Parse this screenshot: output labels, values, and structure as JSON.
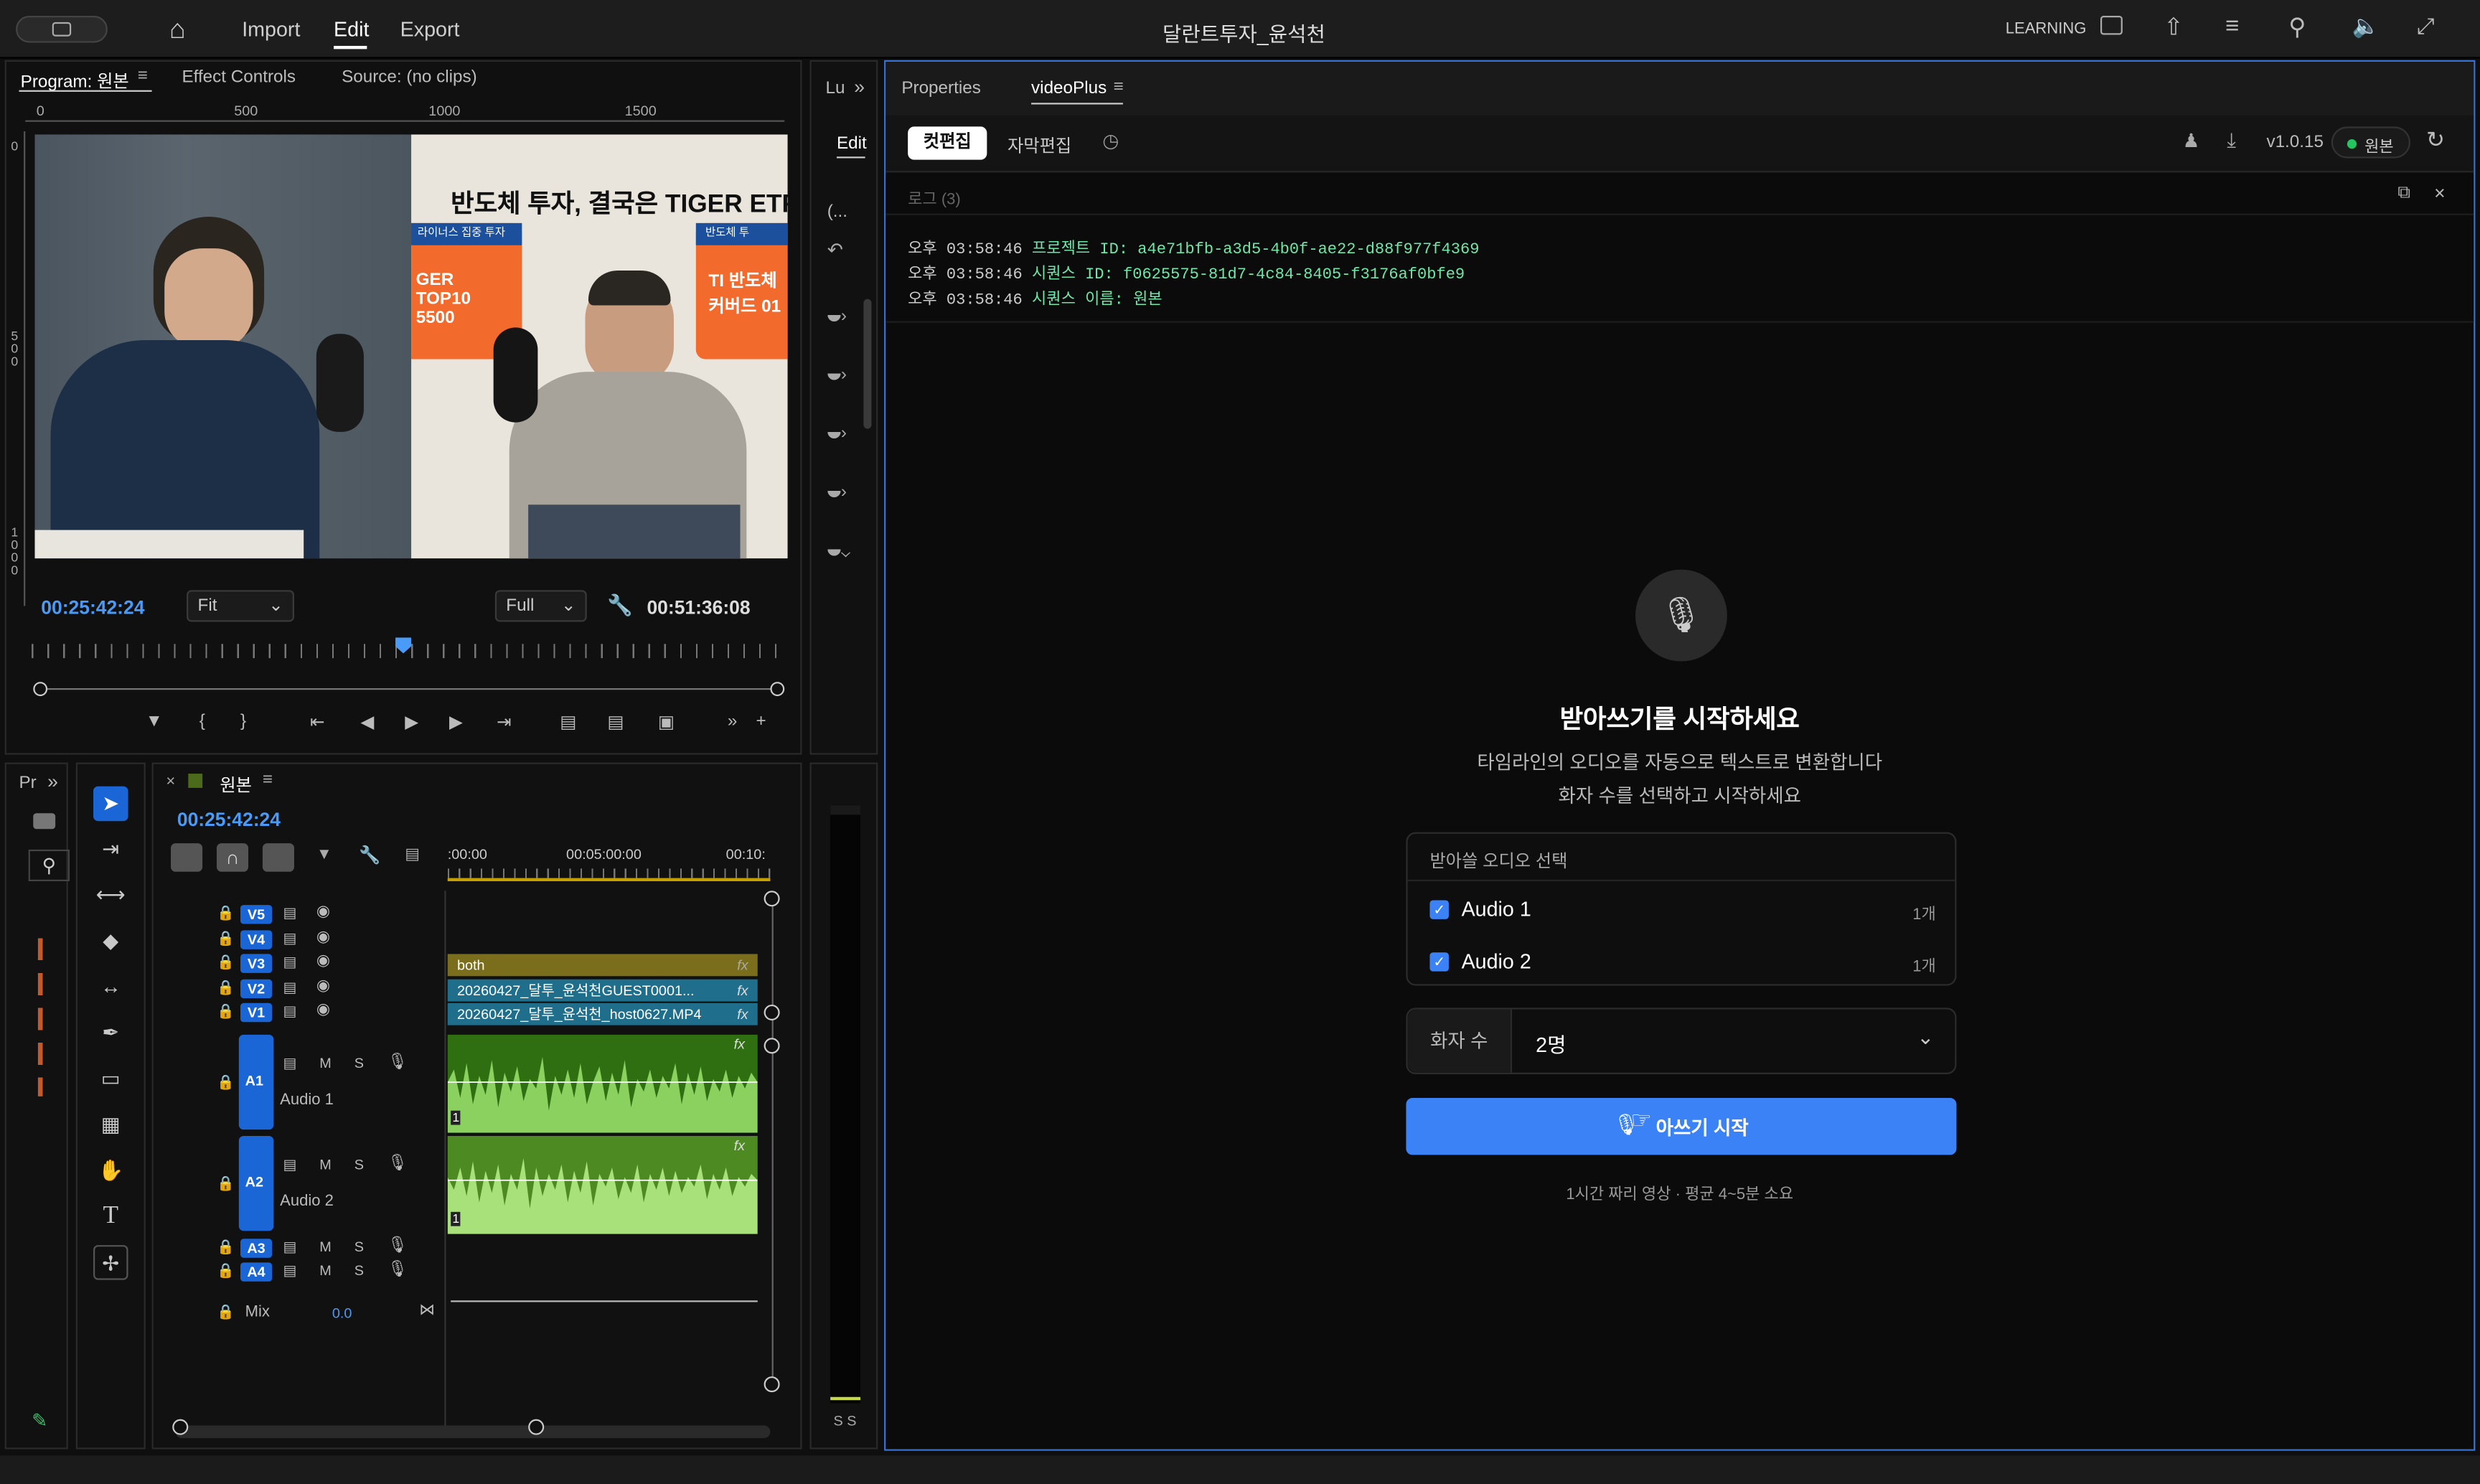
{
  "topbar": {
    "nav": [
      "Import",
      "Edit",
      "Export"
    ],
    "title": "달란트투자_윤석천",
    "learning": "LEARNING"
  },
  "program": {
    "tab_program": "Program: 원본",
    "tab_effect": "Effect Controls",
    "tab_source": "Source: (no clips)",
    "ruler": [
      "0",
      "500",
      "1000",
      "1500"
    ],
    "timecode": "00:25:42:24",
    "fit": "Fit",
    "full": "Full",
    "duration": "00:51:36:08",
    "banner": "반도체 투자, 결국은 TIGER ETF",
    "card1_top": "라이너스 집중 투자",
    "card1_body": "GER TOP10 5500",
    "card2_top": "반도체 투",
    "card2_body": "TI 반도체 커버드 01",
    "vruler": [
      "0",
      "5 0 0",
      "1 0 0 0"
    ]
  },
  "lumetri": {
    "tab": "Lu",
    "edit": "Edit",
    "paren": "(..."
  },
  "timeline": {
    "proj_tab": "Pr",
    "seq_tab": "원본",
    "timecode": "00:25:42:24",
    "ruler": [
      ":00:00",
      "00:05:00:00",
      "00:10:"
    ],
    "video_tracks": [
      "V5",
      "V4",
      "V3",
      "V2",
      "V1"
    ],
    "audio_tracks": [
      {
        "id": "A1",
        "name": "Audio 1"
      },
      {
        "id": "A2",
        "name": "Audio 2"
      }
    ],
    "small_audio": [
      "A3",
      "A4"
    ],
    "mix_label": "Mix",
    "mix_value": "0.0",
    "m": "M",
    "s": "S",
    "clips": {
      "v3": "both",
      "v2": "20260427_달투_윤석천GUEST0001...",
      "v1": "20260427_달투_윤석천_host0627.MP4",
      "fx": "fx",
      "one": "1"
    },
    "meter_ss": "S S"
  },
  "vp": {
    "tab_properties": "Properties",
    "tab_videoplus": "videoPlus",
    "subtab1": "컷편집",
    "subtab2": "자막편집",
    "version": "v1.0.15",
    "status": "원본",
    "log_title": "로그 (3)",
    "logs": [
      {
        "time": "오후 03:58:46",
        "text": "프로젝트 ID: a4e71bfb-a3d5-4b0f-ae22-d88f977f4369"
      },
      {
        "time": "오후 03:58:46",
        "text": "시퀀스 ID: f0625575-81d7-4c84-8405-f3176af0bfe9"
      },
      {
        "time": "오후 03:58:46",
        "text": "시퀀스 이름: 원본"
      }
    ],
    "heading": "받아쓰기를 시작하세요",
    "desc1": "타임라인의 오디오를 자동으로 텍스트로 변환합니다",
    "desc2": "화자 수를 선택하고 시작하세요",
    "audio_section": "받아쓸 오디오 선택",
    "audio_items": [
      {
        "name": "Audio 1",
        "count": "1개"
      },
      {
        "name": "Audio 2",
        "count": "1개"
      }
    ],
    "speaker_label": "화자 수",
    "speaker_value": "2명",
    "start_button": "아쓰기 시작",
    "footer": "1시간 짜리 영상 · 평균 4~5분 소요"
  },
  "colors": {
    "accent": "#3b82f6",
    "green_log": "#6ee7a8",
    "clip_teal": "#1f6e8c",
    "audio_green": "#2f6f12",
    "status_dot": "#22c55e"
  }
}
